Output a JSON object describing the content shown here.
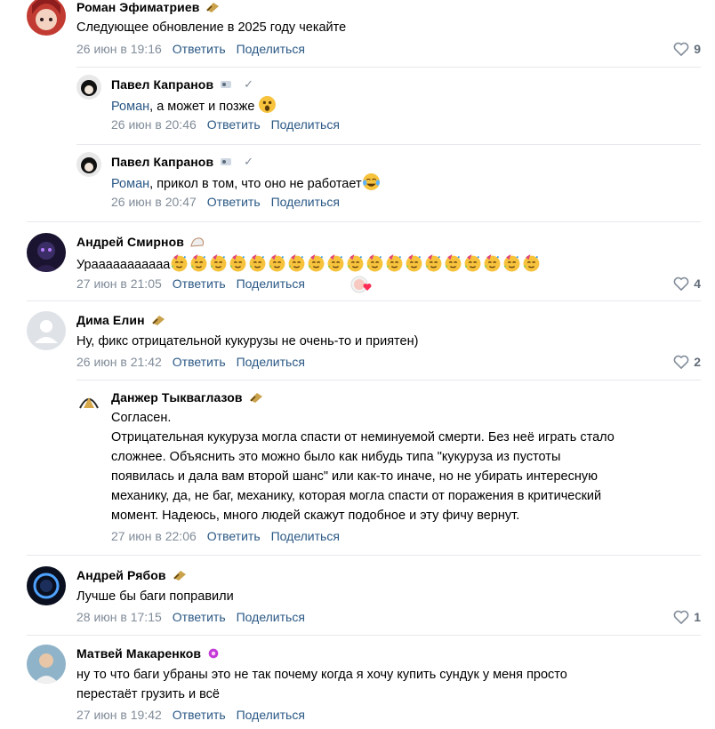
{
  "comments": [
    {
      "author": "Роман Эфиматриев",
      "text": "Следующее обновление в 2025 году чекайте",
      "date": "26 июн в 19:16",
      "reply": "Ответить",
      "share": "Поделиться",
      "likes": "9"
    },
    {
      "author": "Павел Капранов",
      "mention": "Роман",
      "text": ", а может и позже",
      "date": "26 июн в 20:46",
      "reply": "Ответить",
      "share": "Поделиться"
    },
    {
      "author": "Павел Капранов",
      "mention": "Роман",
      "text": ", прикол в том, что оно не работает",
      "date": "26 июн в 20:47",
      "reply": "Ответить",
      "share": "Поделиться"
    },
    {
      "author": "Андрей Смирнов",
      "text": "Урааааааааааа",
      "date": "27 июн в 21:05",
      "reply": "Ответить",
      "share": "Поделиться",
      "likes": "4"
    },
    {
      "author": "Дима Елин",
      "text": "Ну, фикс отрицательной кукурузы не очень-то и приятен)",
      "date": "26 июн в 21:42",
      "reply": "Ответить",
      "share": "Поделиться",
      "likes": "2"
    },
    {
      "author": "Данжер Тыкваглазов",
      "text_lines": [
        "Согласен.",
        "Отрицательная кукуруза могла спасти от неминуемой смерти. Без неё играть стало",
        "сложнее. Объяснить это можно было как нибудь типа \"кукуруза из пустоты",
        "появилась и дала вам второй шанс\" или как-то иначе, но не убирать интересную",
        "механику, да, не баг, механику, которая могла спасти от поражения в критический",
        "момент. Надеюсь, много людей скажут подобное и эту фичу вернут."
      ],
      "date": "27 июн в 22:06",
      "reply": "Ответить",
      "share": "Поделиться"
    },
    {
      "author": "Андрей Рябов",
      "text": "Лучше бы баги поправили",
      "date": "28 июн в 17:15",
      "reply": "Ответить",
      "share": "Поделиться",
      "likes": "1"
    },
    {
      "author": "Матвей Макаренков",
      "text_lines": [
        "ну то что баги убраны это не так почему когда я хочу купить сундук у меня просто",
        "перестаёт грузить и всё"
      ],
      "date": "27 июн в 19:42",
      "reply": "Ответить",
      "share": "Поделиться"
    }
  ],
  "colors": {
    "link": "#2a5885",
    "meta": "#818c99",
    "divider": "#e7e8ec"
  }
}
